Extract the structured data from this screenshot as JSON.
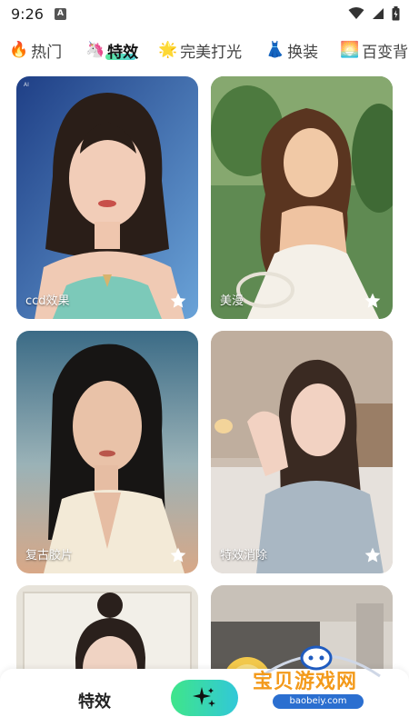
{
  "status_bar": {
    "time": "9:26",
    "notification_badge": "A"
  },
  "tabs": [
    {
      "emoji": "🔥",
      "label": "热门"
    },
    {
      "emoji": "🦄",
      "label": "特效"
    },
    {
      "emoji": "🌟",
      "label": "完美打光"
    },
    {
      "emoji": "👗",
      "label": "换装"
    },
    {
      "emoji": "🌅",
      "label": "百变背"
    }
  ],
  "active_tab": "特效",
  "cards": [
    {
      "label": "ccd效果",
      "icon": "star-icon"
    },
    {
      "label": "美漫",
      "icon": "star-icon"
    },
    {
      "label": "复古胶片",
      "icon": "star-icon"
    },
    {
      "label": "特效消除",
      "icon": "star-icon"
    },
    {
      "label": "",
      "icon": "star-icon"
    },
    {
      "label": "",
      "icon": "star-icon"
    }
  ],
  "bottom_bar": {
    "title": "特效",
    "fab_icon": "sparkle-icon"
  },
  "watermark": {
    "title": "宝贝游戏网",
    "url": "baobeiy.com"
  },
  "colors": {
    "accent_start": "#3fe58a",
    "accent_end": "#31c8d8",
    "watermark_orange": "#f39a1b",
    "watermark_blue": "#2b6fd0"
  }
}
